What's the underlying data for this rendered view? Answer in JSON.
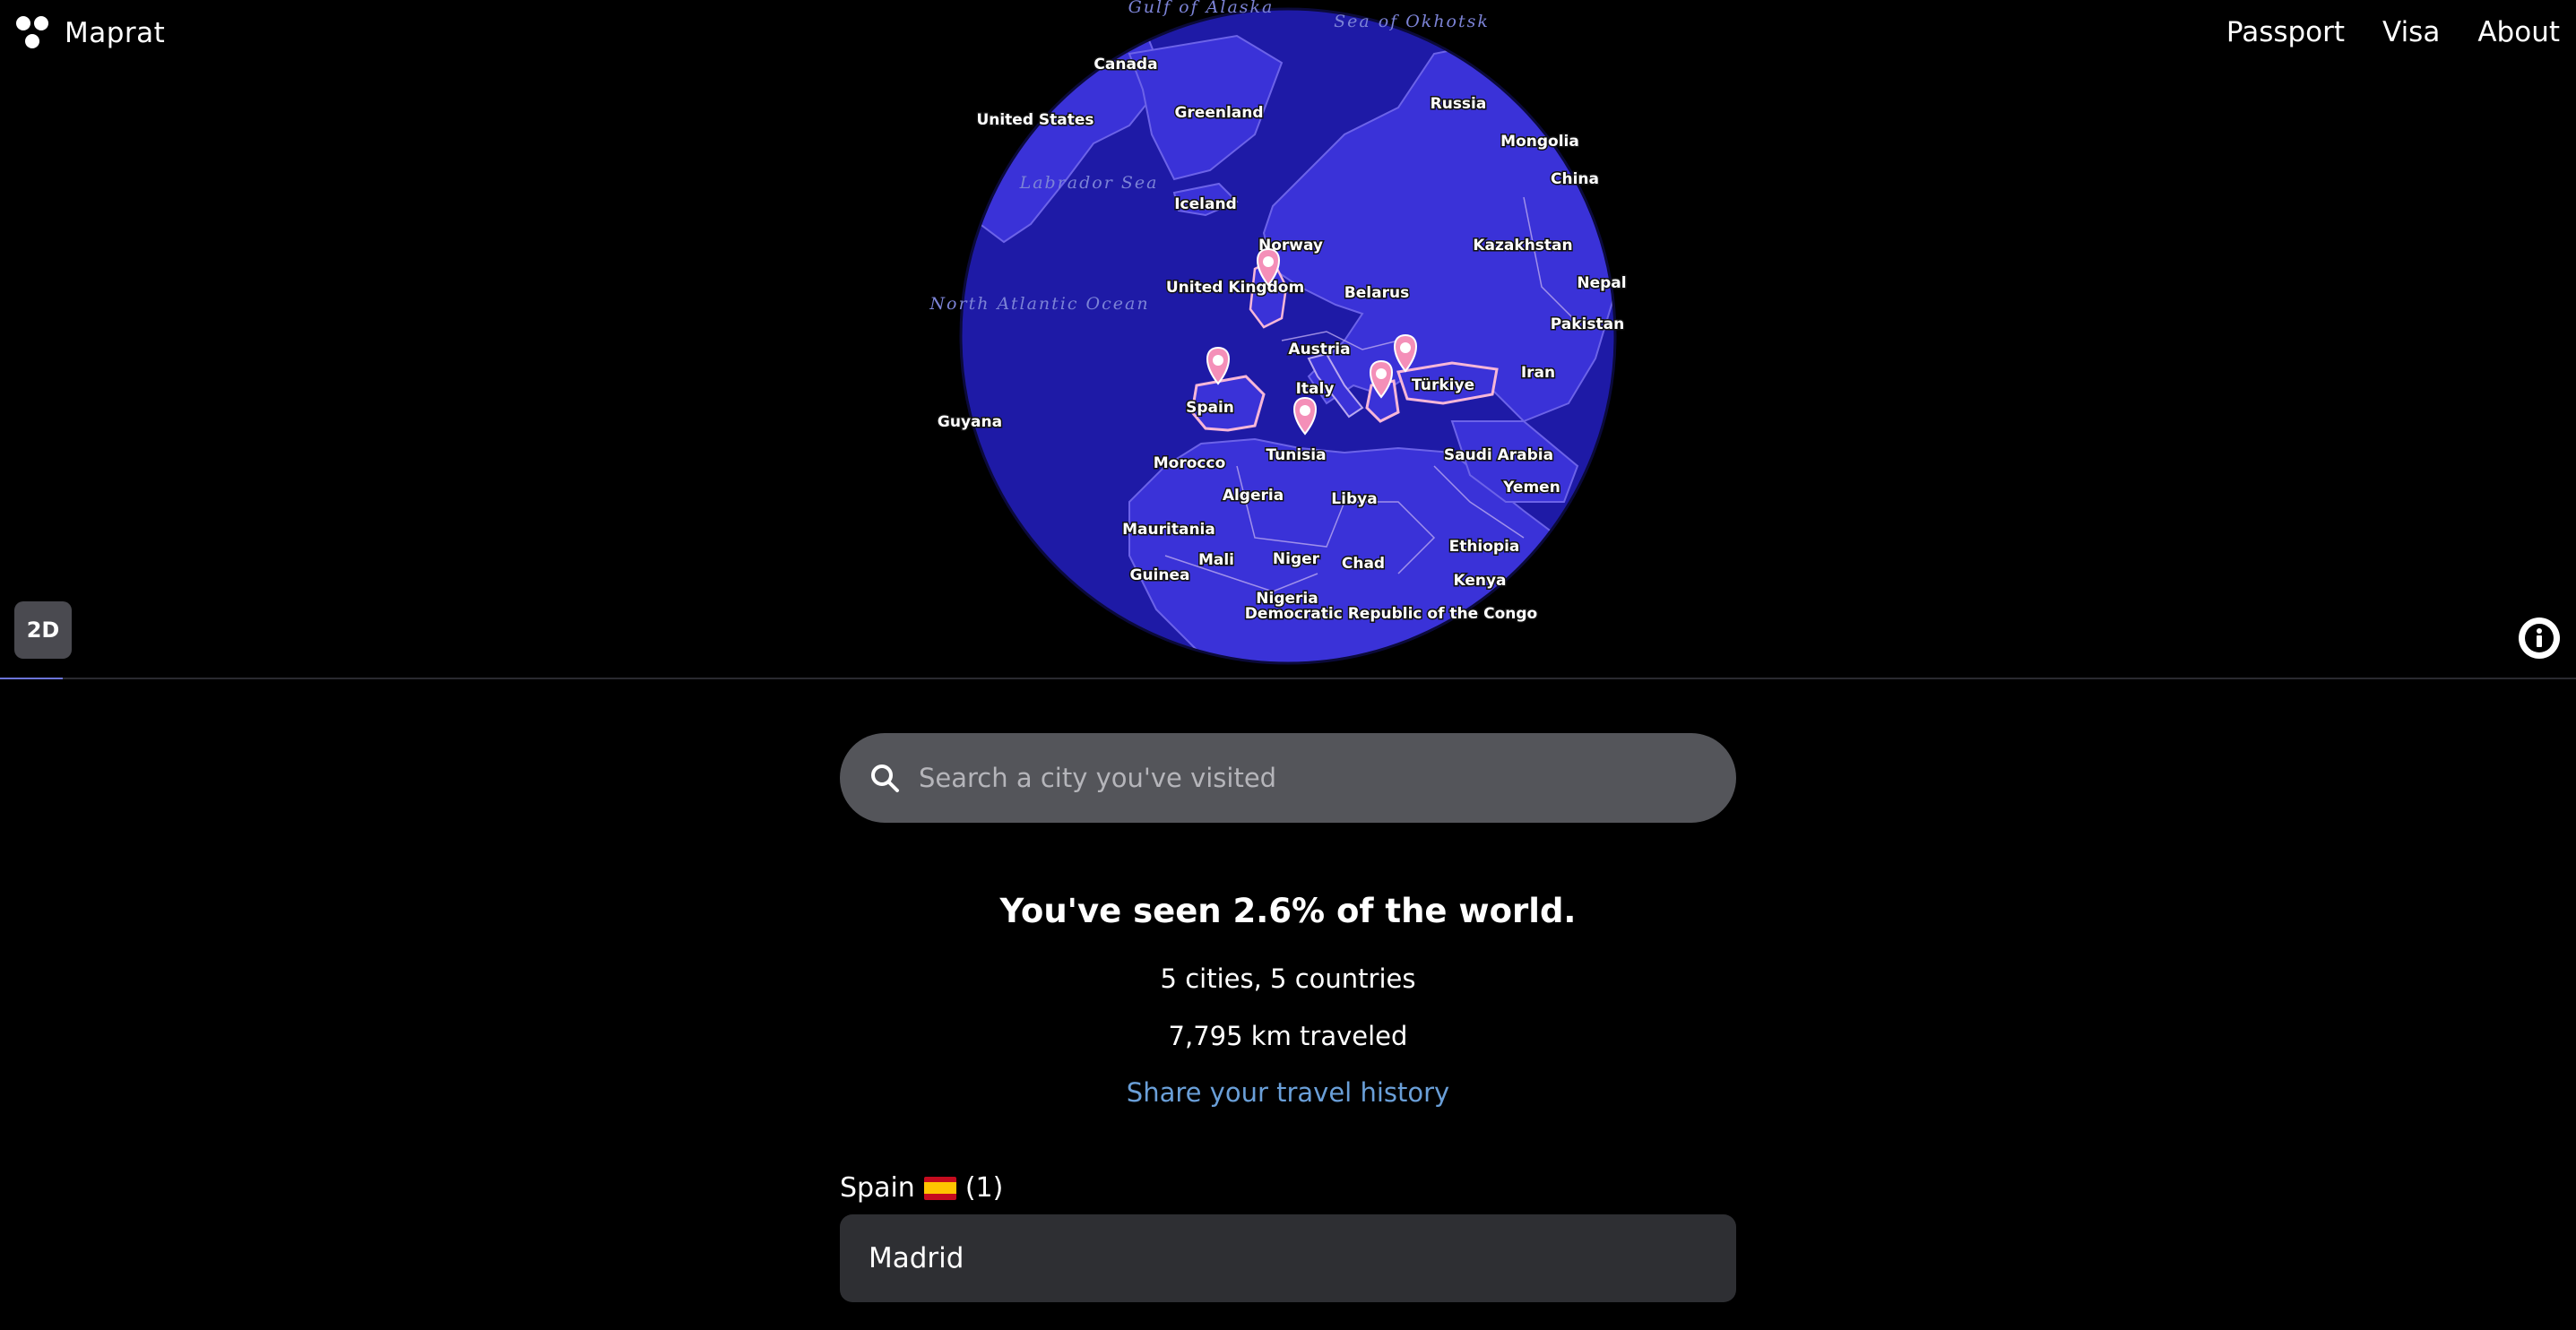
{
  "header": {
    "app_name": "Maprat",
    "nav": [
      "Passport",
      "Visa",
      "About"
    ]
  },
  "map": {
    "toggle_label": "2D",
    "colors": {
      "land": "#3a32d8",
      "water": "#1e1aa6",
      "border": "#b9a8f0",
      "visited_border": "#f7b7d8",
      "pin": "#f48fb8"
    },
    "countries": [
      "Canada",
      "Greenland",
      "United States",
      "Iceland",
      "Russia",
      "Mongolia",
      "China",
      "Norway",
      "United Kingdom",
      "Belarus",
      "Kazakhstan",
      "Nepal",
      "Pakistan",
      "Austria",
      "Spain",
      "Italy",
      "Türkiye",
      "Iran",
      "Tunisia",
      "Morocco",
      "Saudi Arabia",
      "Algeria",
      "Libya",
      "Yemen",
      "Mauritania",
      "Ethiopia",
      "Mali",
      "Niger",
      "Chad",
      "Guinea",
      "Kenya",
      "Nigeria",
      "Democratic Republic of the Congo",
      "Guyana"
    ],
    "oceans": [
      "North Atlantic Ocean",
      "Gulf of Alaska",
      "Sea of Okhotsk",
      "Labrador Sea"
    ],
    "pins": [
      "United Kingdom",
      "Spain",
      "Tunisia",
      "Greece",
      "Türkiye"
    ]
  },
  "search": {
    "placeholder": "Search a city you've visited"
  },
  "stats": {
    "headline": "You've seen 2.6% of the world.",
    "cities_countries": "5 cities, 5 countries",
    "distance": "7,795 km traveled",
    "share_link": "Share your travel history"
  },
  "visited": [
    {
      "country": "Spain",
      "flag": "🇪🇸",
      "count": "(1)",
      "cities": [
        "Madrid"
      ]
    }
  ]
}
